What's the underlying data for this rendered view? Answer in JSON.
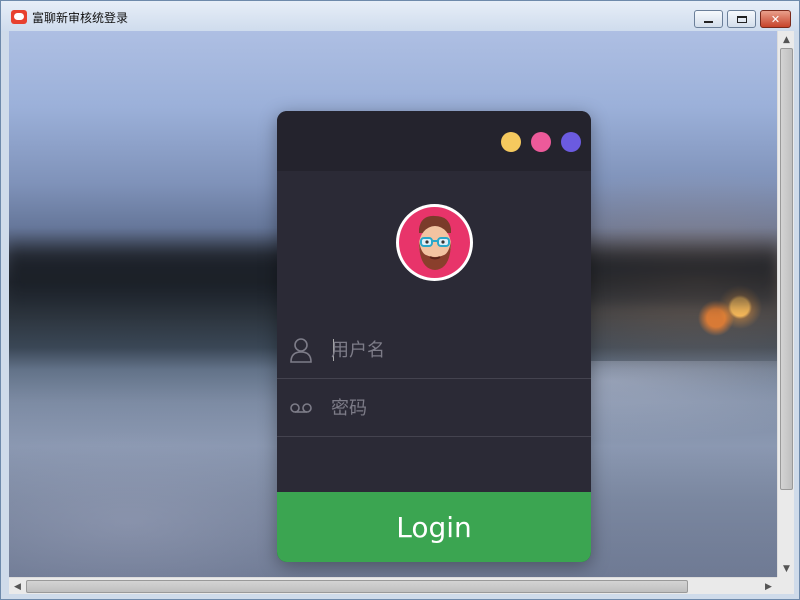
{
  "window": {
    "title": "富聊新审核统登录",
    "minimize_label": "",
    "maximize_label": "",
    "close_label": "✕"
  },
  "login": {
    "username_placeholder": "用户名",
    "password_placeholder": "密码",
    "button_label": "Login",
    "header_dots": [
      "#f5c95e",
      "#ec5a9a",
      "#6b5be0"
    ],
    "button_color": "#3ba551",
    "card_color": "#2b2a36"
  },
  "icons": {
    "app": "app-chat-icon",
    "username": "user-icon",
    "password": "voicemail-icon",
    "avatar": "bearded-man-avatar"
  },
  "scrollbars": {
    "up": "▲",
    "down": "▼",
    "left": "◀",
    "right": "▶"
  }
}
